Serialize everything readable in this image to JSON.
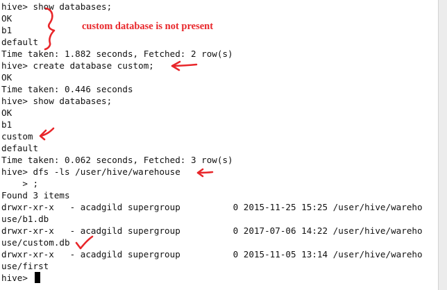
{
  "terminal": {
    "lines": [
      "hive> show databases;",
      "OK",
      "b1",
      "default",
      "Time taken: 1.882 seconds, Fetched: 2 row(s)",
      "hive> create database custom;",
      "OK",
      "Time taken: 0.446 seconds",
      "hive> show databases;",
      "OK",
      "b1",
      "custom",
      "default",
      "Time taken: 0.062 seconds, Fetched: 3 row(s)",
      "hive> dfs -ls /user/hive/warehouse",
      "    > ;",
      "Found 3 items",
      "drwxr-xr-x   - acadgild supergroup          0 2015-11-25 15:25 /user/hive/wareho",
      "use/b1.db",
      "drwxr-xr-x   - acadgild supergroup          0 2017-07-06 14:22 /user/hive/wareho",
      "use/custom.db",
      "drwxr-xr-x   - acadgild supergroup          0 2015-11-05 13:14 /user/hive/wareho",
      "use/first",
      "hive> "
    ]
  },
  "annotation": {
    "text": "custom database is not present",
    "color": "#e8262a"
  }
}
